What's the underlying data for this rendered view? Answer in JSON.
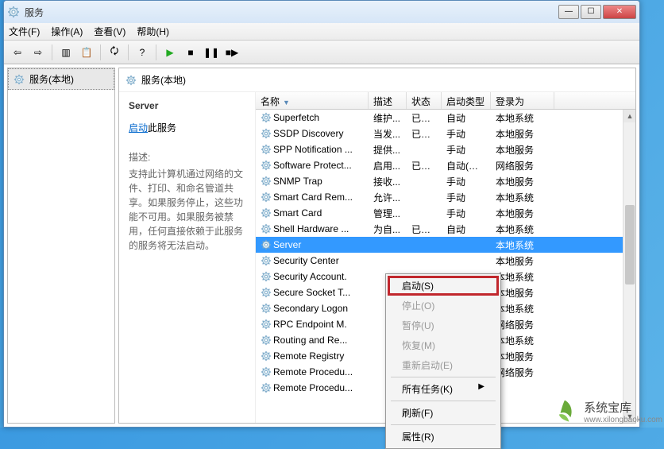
{
  "window": {
    "title": "服务"
  },
  "menubar": {
    "file": "文件(F)",
    "action": "操作(A)",
    "view": "查看(V)",
    "help": "帮助(H)"
  },
  "tree": {
    "root": "服务(本地)"
  },
  "header_title": "服务(本地)",
  "detail": {
    "title": "Server",
    "start_link": "启动",
    "start_suffix": "此服务",
    "desc_label": "描述:",
    "desc": "支持此计算机通过网络的文件、打印、和命名管道共享。如果服务停止，这些功能不可用。如果服务被禁用，任何直接依赖于此服务的服务将无法启动。"
  },
  "columns": {
    "name": "名称",
    "desc": "描述",
    "status": "状态",
    "startup": "启动类型",
    "logon": "登录为"
  },
  "services": [
    {
      "name": "Superfetch",
      "desc": "维护...",
      "status": "已启动",
      "startup": "自动",
      "logon": "本地系统"
    },
    {
      "name": "SSDP Discovery",
      "desc": "当发...",
      "status": "已启动",
      "startup": "手动",
      "logon": "本地服务"
    },
    {
      "name": "SPP Notification ...",
      "desc": "提供...",
      "status": "",
      "startup": "手动",
      "logon": "本地服务"
    },
    {
      "name": "Software Protect...",
      "desc": "启用...",
      "status": "已启动",
      "startup": "自动(延迟...",
      "logon": "网络服务"
    },
    {
      "name": "SNMP Trap",
      "desc": "接收...",
      "status": "",
      "startup": "手动",
      "logon": "本地服务"
    },
    {
      "name": "Smart Card Rem...",
      "desc": "允许...",
      "status": "",
      "startup": "手动",
      "logon": "本地系统"
    },
    {
      "name": "Smart Card",
      "desc": "管理...",
      "status": "",
      "startup": "手动",
      "logon": "本地服务"
    },
    {
      "name": "Shell Hardware ...",
      "desc": "为自...",
      "status": "已启动",
      "startup": "自动",
      "logon": "本地系统"
    },
    {
      "name": "Server",
      "desc": "",
      "status": "",
      "startup": "",
      "logon": "本地系统",
      "selected": true
    },
    {
      "name": "Security Center",
      "desc": "",
      "status": "",
      "startup": "",
      "logon": "本地服务"
    },
    {
      "name": "Security Account.",
      "desc": "",
      "status": "",
      "startup": "",
      "logon": "本地系统"
    },
    {
      "name": "Secure Socket T...",
      "desc": "",
      "status": "",
      "startup": "",
      "logon": "本地服务"
    },
    {
      "name": "Secondary Logon",
      "desc": "",
      "status": "",
      "startup": "",
      "logon": "本地系统"
    },
    {
      "name": "RPC Endpoint M.",
      "desc": "",
      "status": "",
      "startup": "",
      "logon": "网络服务"
    },
    {
      "name": "Routing and Re...",
      "desc": "",
      "status": "",
      "startup": "",
      "logon": "本地系统"
    },
    {
      "name": "Remote Registry",
      "desc": "",
      "status": "",
      "startup": "",
      "logon": "本地服务"
    },
    {
      "name": "Remote Procedu...",
      "desc": "",
      "status": "",
      "startup": "",
      "logon": "网络服务"
    },
    {
      "name": "Remote Procedu...",
      "desc": "",
      "status": "",
      "startup": "",
      "logon": ""
    }
  ],
  "context_menu": {
    "start": "启动(S)",
    "stop": "停止(O)",
    "pause": "暂停(U)",
    "resume": "恢复(M)",
    "restart": "重新启动(E)",
    "all_tasks": "所有任务(K)",
    "refresh": "刷新(F)",
    "properties": "属性(R)"
  },
  "watermark": {
    "text": "系统宝库",
    "url": "www.xilongbaoku.com"
  }
}
